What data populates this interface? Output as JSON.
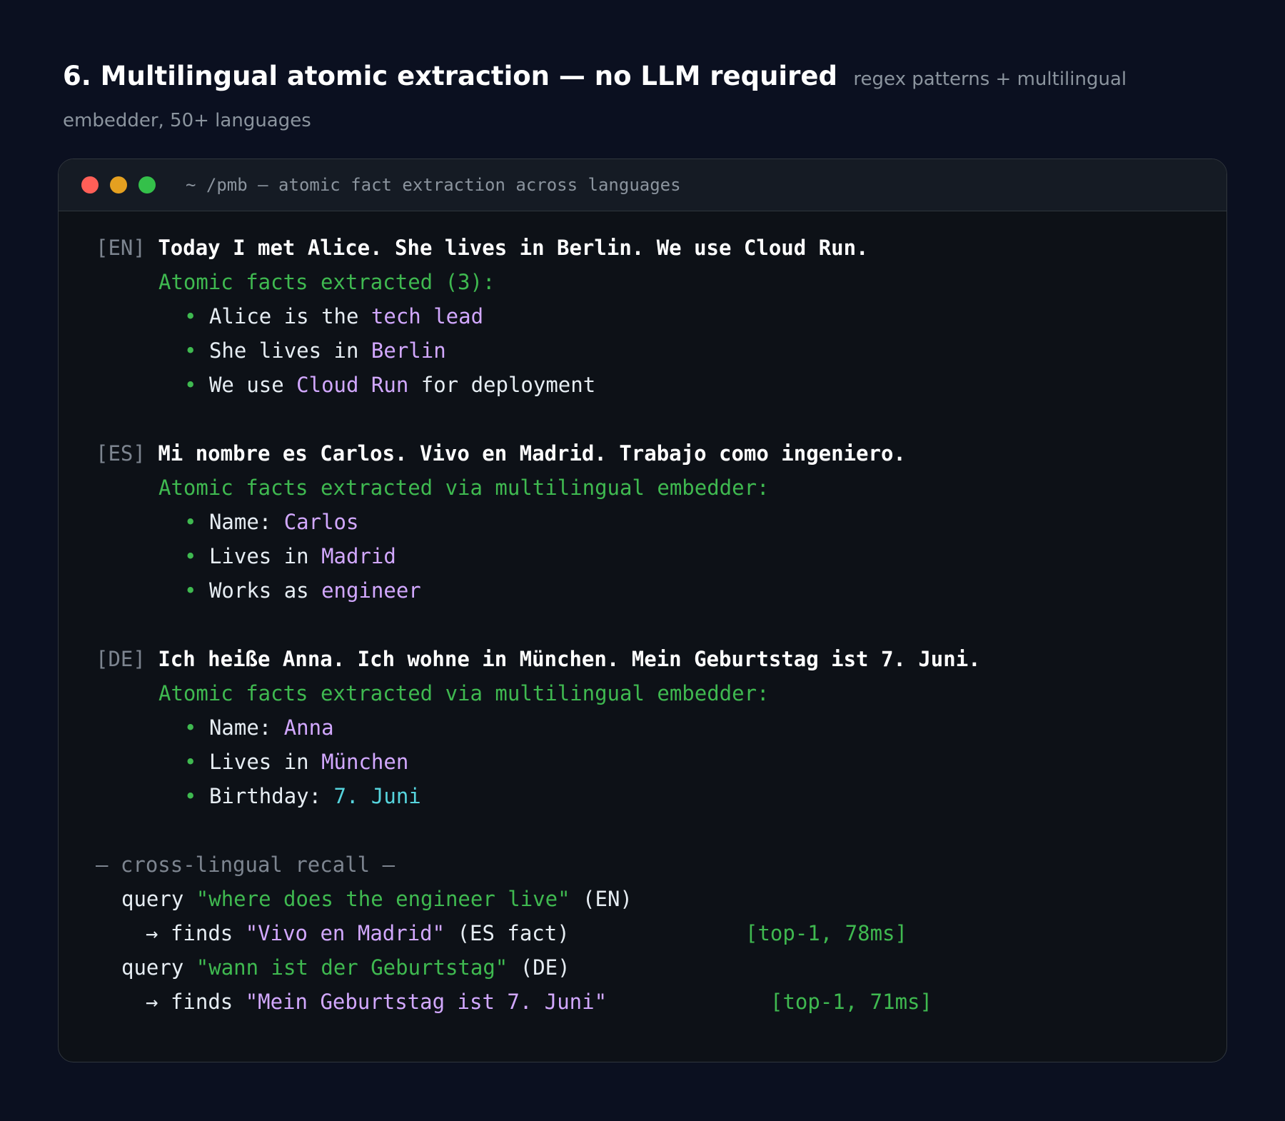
{
  "heading": {
    "title": "6. Multilingual atomic extraction — no LLM required",
    "subtitle": "regex patterns + multilingual embedder, 50+ languages"
  },
  "terminal": {
    "title": "~ /pmb — atomic fact extraction across languages",
    "window_controls": [
      "close",
      "minimize",
      "maximize"
    ],
    "blocks": [
      {
        "tag": "[EN]",
        "input": "Today I met Alice. She lives in Berlin. We use Cloud Run.",
        "header": "Atomic facts extracted (3):",
        "facts": [
          {
            "bullet": "•",
            "prefix": "Alice is the ",
            "value": "tech lead",
            "suffix": ""
          },
          {
            "bullet": "•",
            "prefix": "She lives in ",
            "value": "Berlin",
            "suffix": ""
          },
          {
            "bullet": "•",
            "prefix": "We use ",
            "value": "Cloud Run",
            "suffix": " for deployment"
          }
        ]
      },
      {
        "tag": "[ES]",
        "input": "Mi nombre es Carlos. Vivo en Madrid. Trabajo como ingeniero.",
        "header": "Atomic facts extracted via multilingual embedder:",
        "facts": [
          {
            "bullet": "•",
            "prefix": "Name: ",
            "value": "Carlos",
            "suffix": ""
          },
          {
            "bullet": "•",
            "prefix": "Lives in ",
            "value": "Madrid",
            "suffix": ""
          },
          {
            "bullet": "•",
            "prefix": "Works as ",
            "value": "engineer",
            "suffix": ""
          }
        ]
      },
      {
        "tag": "[DE]",
        "input": "Ich heiße Anna. Ich wohne in München. Mein Geburtstag ist 7. Juni.",
        "header": "Atomic facts extracted via multilingual embedder:",
        "facts": [
          {
            "bullet": "•",
            "prefix": "Name: ",
            "value": "Anna",
            "suffix": ""
          },
          {
            "bullet": "•",
            "prefix": "Lives in ",
            "value": "München",
            "suffix": ""
          },
          {
            "bullet": "•",
            "prefix": "Birthday: ",
            "value": "7. Juni",
            "suffix": "",
            "value_color": "#56d4dd"
          }
        ]
      }
    ],
    "recall": {
      "header": "— cross-lingual recall —",
      "items": [
        {
          "query_word": "query",
          "query_text": "\"where does the engineer live\"",
          "query_lang": "(EN)",
          "arrow": "→",
          "finds_word": "finds",
          "result": "\"Vivo en Madrid\"",
          "result_note": "(ES fact)",
          "timing": "[top-1, 78ms]"
        },
        {
          "query_word": "query",
          "query_text": "\"wann ist der Geburtstag\"",
          "query_lang": "(DE)",
          "arrow": "→",
          "finds_word": "finds",
          "result": "\"Mein Geburtstag ist 7. Juni\"",
          "result_note": "",
          "timing": "[top-1, 71ms]"
        }
      ]
    }
  }
}
